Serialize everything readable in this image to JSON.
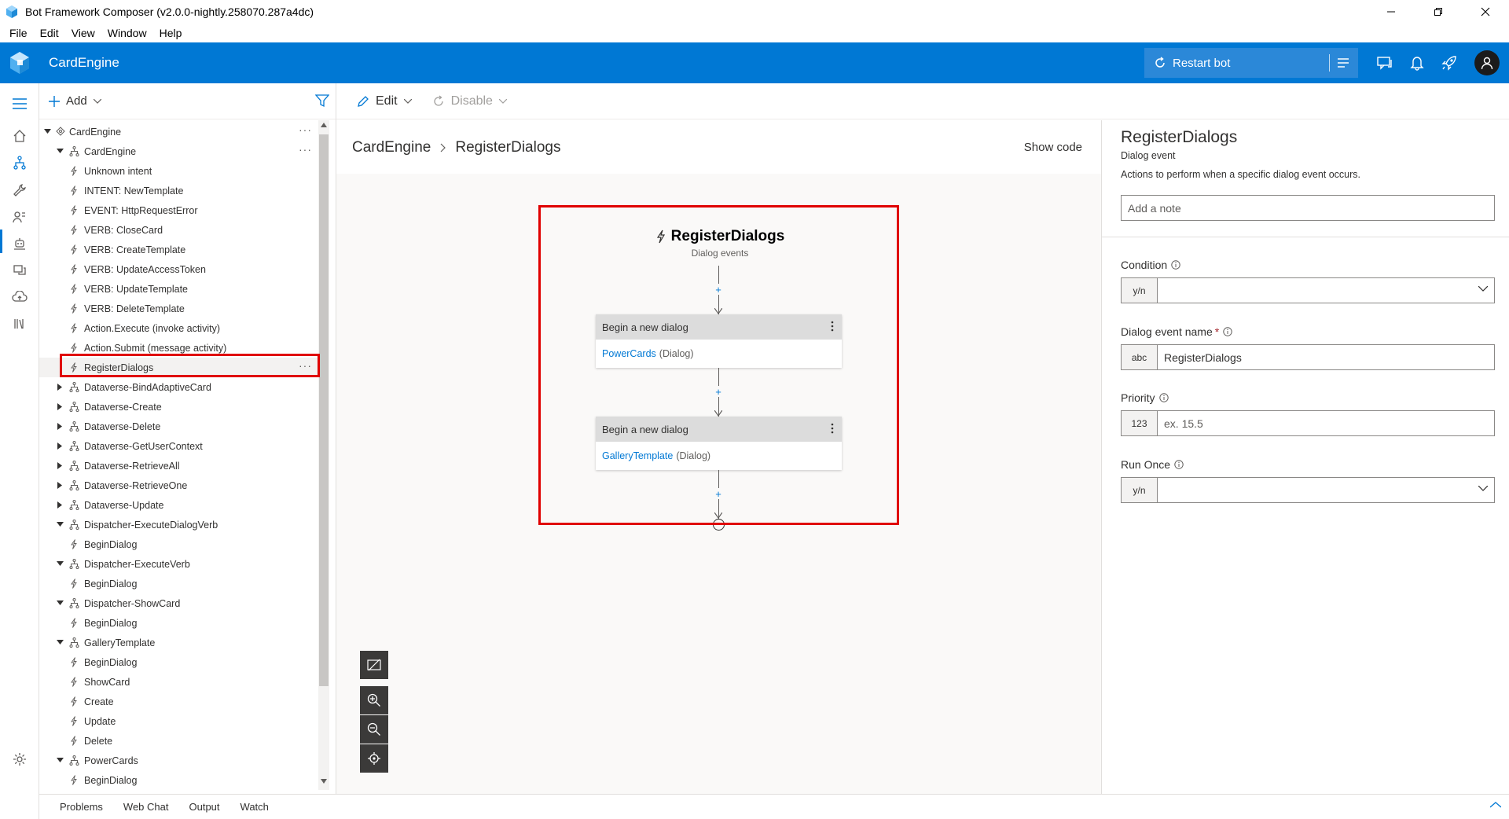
{
  "window": {
    "title": "Bot Framework Composer (v2.0.0-nightly.258070.287a4dc)",
    "controls": [
      "minimize",
      "restore",
      "close"
    ]
  },
  "menu": [
    "File",
    "Edit",
    "View",
    "Window",
    "Help"
  ],
  "header": {
    "bot_name": "CardEngine",
    "restart_label": "Restart bot",
    "accent": "#0078d4"
  },
  "tree_toolbar": {
    "add_label": "Add"
  },
  "tree": [
    {
      "label": "CardEngine",
      "level": 0,
      "type": "bot",
      "expanded": true,
      "more": true
    },
    {
      "label": "CardEngine",
      "level": 1,
      "type": "dialog",
      "expanded": true,
      "more": true
    },
    {
      "label": "Unknown intent",
      "level": 2,
      "type": "trigger"
    },
    {
      "label": "INTENT: NewTemplate",
      "level": 2,
      "type": "trigger"
    },
    {
      "label": "EVENT: HttpRequestError",
      "level": 2,
      "type": "trigger"
    },
    {
      "label": "VERB: CloseCard",
      "level": 2,
      "type": "trigger"
    },
    {
      "label": "VERB: CreateTemplate",
      "level": 2,
      "type": "trigger"
    },
    {
      "label": "VERB: UpdateAccessToken",
      "level": 2,
      "type": "trigger"
    },
    {
      "label": "VERB: UpdateTemplate",
      "level": 2,
      "type": "trigger"
    },
    {
      "label": "VERB: DeleteTemplate",
      "level": 2,
      "type": "trigger"
    },
    {
      "label": "Action.Execute (invoke activity)",
      "level": 2,
      "type": "trigger"
    },
    {
      "label": "Action.Submit (message activity)",
      "level": 2,
      "type": "trigger"
    },
    {
      "label": "RegisterDialogs",
      "level": 2,
      "type": "trigger",
      "selected": true,
      "more": true
    },
    {
      "label": "Dataverse-BindAdaptiveCard",
      "level": 1,
      "type": "dialog",
      "expanded": false
    },
    {
      "label": "Dataverse-Create",
      "level": 1,
      "type": "dialog",
      "expanded": false
    },
    {
      "label": "Dataverse-Delete",
      "level": 1,
      "type": "dialog",
      "expanded": false
    },
    {
      "label": "Dataverse-GetUserContext",
      "level": 1,
      "type": "dialog",
      "expanded": false
    },
    {
      "label": "Dataverse-RetrieveAll",
      "level": 1,
      "type": "dialog",
      "expanded": false
    },
    {
      "label": "Dataverse-RetrieveOne",
      "level": 1,
      "type": "dialog",
      "expanded": false
    },
    {
      "label": "Dataverse-Update",
      "level": 1,
      "type": "dialog",
      "expanded": false
    },
    {
      "label": "Dispatcher-ExecuteDialogVerb",
      "level": 1,
      "type": "dialog",
      "expanded": true
    },
    {
      "label": "BeginDialog",
      "level": 2,
      "type": "trigger"
    },
    {
      "label": "Dispatcher-ExecuteVerb",
      "level": 1,
      "type": "dialog",
      "expanded": true
    },
    {
      "label": "BeginDialog",
      "level": 2,
      "type": "trigger"
    },
    {
      "label": "Dispatcher-ShowCard",
      "level": 1,
      "type": "dialog",
      "expanded": true
    },
    {
      "label": "BeginDialog",
      "level": 2,
      "type": "trigger"
    },
    {
      "label": "GalleryTemplate",
      "level": 1,
      "type": "dialog",
      "expanded": true
    },
    {
      "label": "BeginDialog",
      "level": 2,
      "type": "trigger"
    },
    {
      "label": "ShowCard",
      "level": 2,
      "type": "trigger"
    },
    {
      "label": "Create",
      "level": 2,
      "type": "trigger"
    },
    {
      "label": "Update",
      "level": 2,
      "type": "trigger"
    },
    {
      "label": "Delete",
      "level": 2,
      "type": "trigger"
    },
    {
      "label": "PowerCards",
      "level": 1,
      "type": "dialog",
      "expanded": true
    },
    {
      "label": "BeginDialog",
      "level": 2,
      "type": "trigger"
    }
  ],
  "main_toolbar": {
    "edit_label": "Edit",
    "disable_label": "Disable"
  },
  "breadcrumb": [
    "CardEngine",
    "RegisterDialogs"
  ],
  "show_code_label": "Show code",
  "flow": {
    "title": "RegisterDialogs",
    "subtitle": "Dialog events",
    "actions": [
      {
        "header": "Begin a new dialog",
        "link": "PowerCards",
        "kind": "(Dialog)"
      },
      {
        "header": "Begin a new dialog",
        "link": "GalleryTemplate",
        "kind": "(Dialog)"
      }
    ],
    "plus_symbol": "+"
  },
  "properties": {
    "title": "RegisterDialogs",
    "subtitle": "Dialog event",
    "description": "Actions to perform when a specific dialog event occurs.",
    "note_placeholder": "Add a note",
    "fields": [
      {
        "label": "Condition",
        "type": "y/n",
        "value": "",
        "required": false,
        "dropdown": true
      },
      {
        "label": "Dialog event name",
        "type": "abc",
        "value": "RegisterDialogs",
        "required": true,
        "dropdown": false
      },
      {
        "label": "Priority",
        "type": "123",
        "value": "ex. 15.5",
        "placeholder": true,
        "required": false,
        "dropdown": false
      },
      {
        "label": "Run Once",
        "type": "y/n",
        "value": "",
        "required": false,
        "dropdown": true
      }
    ],
    "required_mark": "*"
  },
  "bottom_tabs": [
    "Problems",
    "Web Chat",
    "Output",
    "Watch"
  ]
}
